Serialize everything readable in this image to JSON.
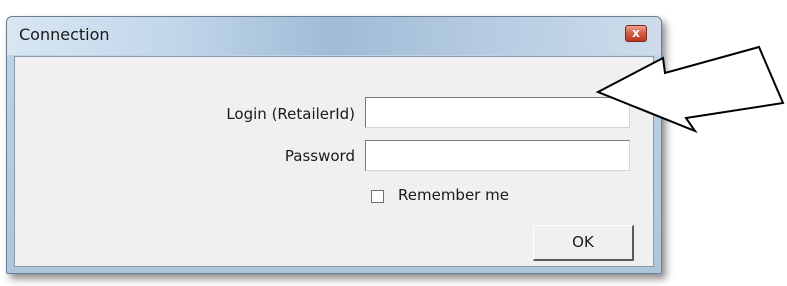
{
  "window": {
    "title": "Connection",
    "close_glyph": "x",
    "close_icon": "close-icon"
  },
  "form": {
    "login_label": "Login (RetailerId)",
    "login_value": "",
    "password_label": "Password",
    "password_value": "",
    "remember_label": "Remember me",
    "remember_checked": false,
    "ok_label": "OK"
  },
  "annotation": {
    "icon": "left-arrow-icon"
  },
  "colors": {
    "titlebar": "#b7cde2",
    "close_button": "#d65a40",
    "client_background": "#f0f0f0"
  }
}
